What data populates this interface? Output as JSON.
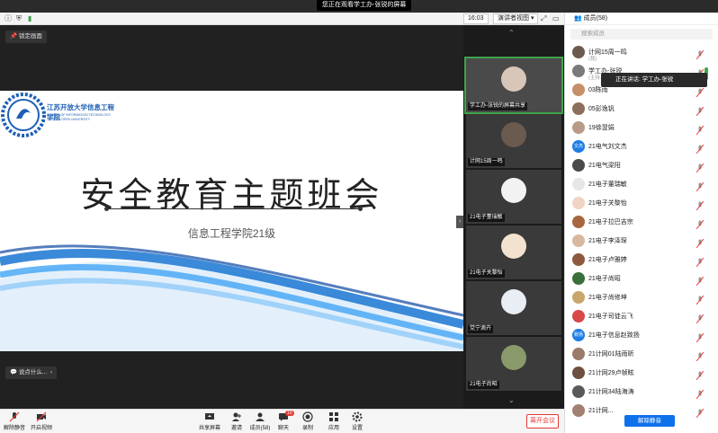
{
  "share_banner": "您正在观看学工办-张锐的屏幕",
  "topbar": {
    "time": "16:03",
    "view_button": "演讲者视图"
  },
  "stage": {
    "lock_button": "锁定画面",
    "say_button": "说点什么...",
    "slide": {
      "logo_text": "江苏开放大学信息工程学院",
      "logo_sub1": "SCHOOL OF INFORMATION TECHNOLOGY",
      "logo_sub2": "JIANGSU OPEN UNIVERSITY",
      "title": "安全教育主题班会",
      "subtitle": "信息工程学院21级"
    }
  },
  "gallery": {
    "tiles": [
      {
        "name": "学工办-张锐的屏幕共享"
      },
      {
        "name": "计网15周一鸣"
      },
      {
        "name": "21电子董瑞敏"
      },
      {
        "name": "21电子关黎怡"
      },
      {
        "name": "党宁滴卉"
      },
      {
        "name": "21电子尚昭"
      }
    ]
  },
  "panel": {
    "title": "成员(58)",
    "search_placeholder": "搜索成员",
    "speaking": "正在讲话: 学工办-张锐",
    "unmute_all": "解除静音",
    "members": [
      {
        "name": "计网15周一鸣",
        "sub": "(我)",
        "color": "#6b5a4e"
      },
      {
        "name": "学工办-张锐",
        "sub": "(主持人",
        "color": "#7a7a7a"
      },
      {
        "name": "03陈雨",
        "sub": "",
        "color": "#c58f6a"
      },
      {
        "name": "05彭逸钒",
        "sub": "",
        "color": "#8c6e5d"
      },
      {
        "name": "19徐翌娟",
        "sub": "",
        "color": "#b99c88"
      },
      {
        "name": "21电气刘文杰",
        "sub": "",
        "color": "#1e7ee6",
        "tag": "文杰"
      },
      {
        "name": "21电气梁阳",
        "sub": "",
        "color": "#4a4a4a"
      },
      {
        "name": "21电子董瑞敏",
        "sub": "",
        "color": "#e6e6e6"
      },
      {
        "name": "21电子关黎怡",
        "sub": "",
        "color": "#f0d5c5"
      },
      {
        "name": "21电子拉巴吉宗",
        "sub": "",
        "color": "#a7663f"
      },
      {
        "name": "21电子李泽琛",
        "sub": "",
        "color": "#d8b8a0"
      },
      {
        "name": "21电子卢雅婷",
        "sub": "",
        "color": "#8d5a3d"
      },
      {
        "name": "21电子尚昭",
        "sub": "",
        "color": "#3a6e3a"
      },
      {
        "name": "21电子尚修坤",
        "sub": "",
        "color": "#c9a66b"
      },
      {
        "name": "21电子司徒云飞",
        "sub": "",
        "color": "#d94848"
      },
      {
        "name": "21电子信息赵致扬",
        "sub": "",
        "color": "#1e7ee6",
        "tag": "致扬"
      },
      {
        "name": "21计网01陆雨昕",
        "sub": "",
        "color": "#9a7a6a"
      },
      {
        "name": "21计网29卢帧眩",
        "sub": "",
        "color": "#6e5040"
      },
      {
        "name": "21计网34陆海涛",
        "sub": "",
        "color": "#5a5a5a"
      },
      {
        "name": "21计网...",
        "sub": "",
        "color": "#a08070"
      }
    ]
  },
  "bottombar": {
    "mute": "解除静音",
    "video": "开启视频",
    "share": "共享屏幕",
    "invite": "邀请",
    "members": "成员(58)",
    "chat": "聊天",
    "chat_badge": "10",
    "record": "录制",
    "apps": "应用",
    "settings": "设置",
    "leave": "离开会议"
  },
  "colors": {
    "accent": "#0e71eb",
    "danger": "#e53935",
    "speaker_green": "#3fa34d"
  }
}
